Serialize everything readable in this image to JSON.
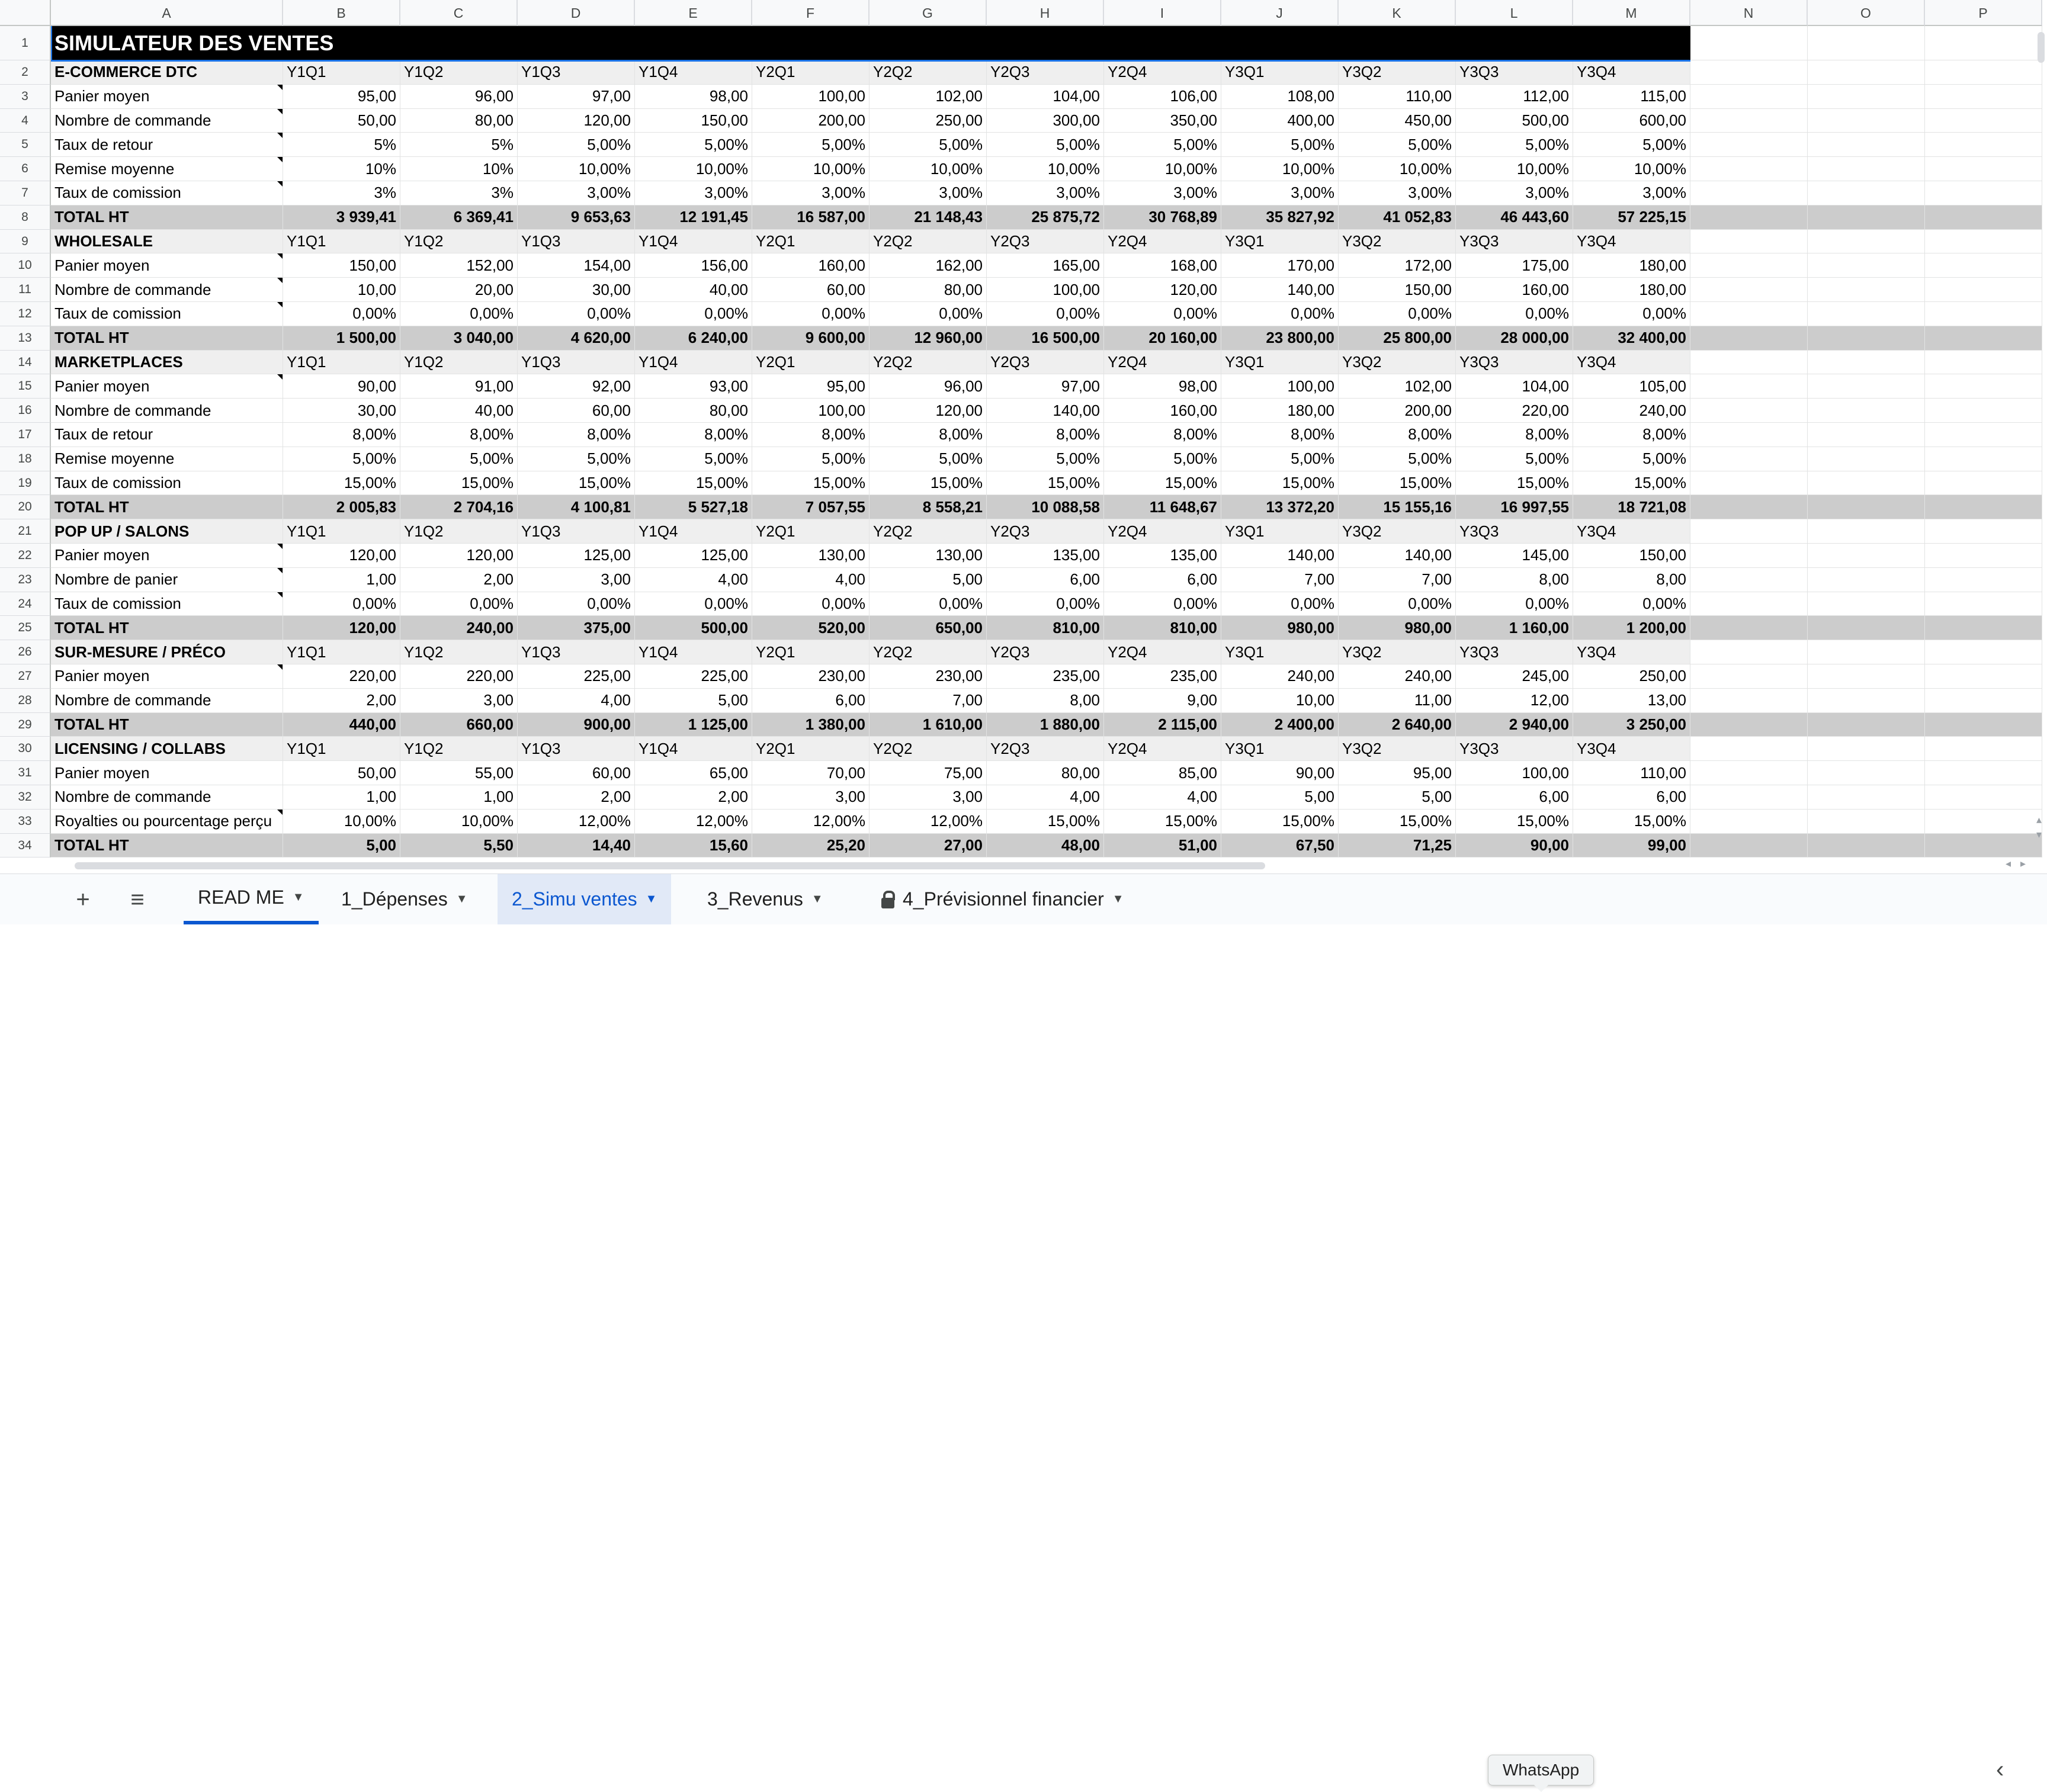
{
  "columns": [
    "A",
    "B",
    "C",
    "D",
    "E",
    "F",
    "G",
    "H",
    "I",
    "J",
    "K",
    "L",
    "M",
    "N",
    "O",
    "P"
  ],
  "title": "SIMULATEUR DES VENTES",
  "rows": [
    {
      "n": "2",
      "kind": "section",
      "label": "E-COMMERCE DTC",
      "values": [
        "Y1Q1",
        "Y1Q2",
        "Y1Q3",
        "Y1Q4",
        "Y2Q1",
        "Y2Q2",
        "Y2Q3",
        "Y2Q4",
        "Y3Q1",
        "Y3Q2",
        "Y3Q3",
        "Y3Q4"
      ]
    },
    {
      "n": "3",
      "kind": "data",
      "label": "Panier moyen",
      "note": true,
      "values": [
        "95,00",
        "96,00",
        "97,00",
        "98,00",
        "100,00",
        "102,00",
        "104,00",
        "106,00",
        "108,00",
        "110,00",
        "112,00",
        "115,00"
      ]
    },
    {
      "n": "4",
      "kind": "data",
      "label": "Nombre de commande",
      "note": true,
      "values": [
        "50,00",
        "80,00",
        "120,00",
        "150,00",
        "200,00",
        "250,00",
        "300,00",
        "350,00",
        "400,00",
        "450,00",
        "500,00",
        "600,00"
      ]
    },
    {
      "n": "5",
      "kind": "data",
      "label": "Taux de retour",
      "note": true,
      "values": [
        "5%",
        "5%",
        "5,00%",
        "5,00%",
        "5,00%",
        "5,00%",
        "5,00%",
        "5,00%",
        "5,00%",
        "5,00%",
        "5,00%",
        "5,00%"
      ]
    },
    {
      "n": "6",
      "kind": "data",
      "label": "Remise moyenne",
      "note": true,
      "values": [
        "10%",
        "10%",
        "10,00%",
        "10,00%",
        "10,00%",
        "10,00%",
        "10,00%",
        "10,00%",
        "10,00%",
        "10,00%",
        "10,00%",
        "10,00%"
      ]
    },
    {
      "n": "7",
      "kind": "data",
      "label": "Taux de comission",
      "note": true,
      "values": [
        "3%",
        "3%",
        "3,00%",
        "3,00%",
        "3,00%",
        "3,00%",
        "3,00%",
        "3,00%",
        "3,00%",
        "3,00%",
        "3,00%",
        "3,00%"
      ]
    },
    {
      "n": "8",
      "kind": "total",
      "label": "TOTAL HT",
      "values": [
        "3 939,41",
        "6 369,41",
        "9 653,63",
        "12 191,45",
        "16 587,00",
        "21 148,43",
        "25 875,72",
        "30 768,89",
        "35 827,92",
        "41 052,83",
        "46 443,60",
        "57 225,15"
      ]
    },
    {
      "n": "9",
      "kind": "section",
      "label": "WHOLESALE",
      "values": [
        "Y1Q1",
        "Y1Q2",
        "Y1Q3",
        "Y1Q4",
        "Y2Q1",
        "Y2Q2",
        "Y2Q3",
        "Y2Q4",
        "Y3Q1",
        "Y3Q2",
        "Y3Q3",
        "Y3Q4"
      ]
    },
    {
      "n": "10",
      "kind": "data",
      "label": "Panier moyen",
      "note": true,
      "values": [
        "150,00",
        "152,00",
        "154,00",
        "156,00",
        "160,00",
        "162,00",
        "165,00",
        "168,00",
        "170,00",
        "172,00",
        "175,00",
        "180,00"
      ]
    },
    {
      "n": "11",
      "kind": "data",
      "label": "Nombre de commande",
      "note": true,
      "values": [
        "10,00",
        "20,00",
        "30,00",
        "40,00",
        "60,00",
        "80,00",
        "100,00",
        "120,00",
        "140,00",
        "150,00",
        "160,00",
        "180,00"
      ]
    },
    {
      "n": "12",
      "kind": "data",
      "label": "Taux de comission",
      "note": true,
      "values": [
        "0,00%",
        "0,00%",
        "0,00%",
        "0,00%",
        "0,00%",
        "0,00%",
        "0,00%",
        "0,00%",
        "0,00%",
        "0,00%",
        "0,00%",
        "0,00%"
      ]
    },
    {
      "n": "13",
      "kind": "total",
      "label": "TOTAL HT",
      "values": [
        "1 500,00",
        "3 040,00",
        "4 620,00",
        "6 240,00",
        "9 600,00",
        "12 960,00",
        "16 500,00",
        "20 160,00",
        "23 800,00",
        "25 800,00",
        "28 000,00",
        "32 400,00"
      ]
    },
    {
      "n": "14",
      "kind": "section",
      "label": "MARKETPLACES",
      "values": [
        "Y1Q1",
        "Y1Q2",
        "Y1Q3",
        "Y1Q4",
        "Y2Q1",
        "Y2Q2",
        "Y2Q3",
        "Y2Q4",
        "Y3Q1",
        "Y3Q2",
        "Y3Q3",
        "Y3Q4"
      ]
    },
    {
      "n": "15",
      "kind": "data",
      "label": "Panier moyen",
      "note": true,
      "values": [
        "90,00",
        "91,00",
        "92,00",
        "93,00",
        "95,00",
        "96,00",
        "97,00",
        "98,00",
        "100,00",
        "102,00",
        "104,00",
        "105,00"
      ]
    },
    {
      "n": "16",
      "kind": "data",
      "label": "Nombre de commande",
      "values": [
        "30,00",
        "40,00",
        "60,00",
        "80,00",
        "100,00",
        "120,00",
        "140,00",
        "160,00",
        "180,00",
        "200,00",
        "220,00",
        "240,00"
      ]
    },
    {
      "n": "17",
      "kind": "data",
      "label": "Taux de retour",
      "values": [
        "8,00%",
        "8,00%",
        "8,00%",
        "8,00%",
        "8,00%",
        "8,00%",
        "8,00%",
        "8,00%",
        "8,00%",
        "8,00%",
        "8,00%",
        "8,00%"
      ]
    },
    {
      "n": "18",
      "kind": "data",
      "label": "Remise moyenne",
      "values": [
        "5,00%",
        "5,00%",
        "5,00%",
        "5,00%",
        "5,00%",
        "5,00%",
        "5,00%",
        "5,00%",
        "5,00%",
        "5,00%",
        "5,00%",
        "5,00%"
      ]
    },
    {
      "n": "19",
      "kind": "data",
      "label": "Taux de comission",
      "values": [
        "15,00%",
        "15,00%",
        "15,00%",
        "15,00%",
        "15,00%",
        "15,00%",
        "15,00%",
        "15,00%",
        "15,00%",
        "15,00%",
        "15,00%",
        "15,00%"
      ]
    },
    {
      "n": "20",
      "kind": "total",
      "label": "TOTAL HT",
      "values": [
        "2 005,83",
        "2 704,16",
        "4 100,81",
        "5 527,18",
        "7 057,55",
        "8 558,21",
        "10 088,58",
        "11 648,67",
        "13 372,20",
        "15 155,16",
        "16 997,55",
        "18 721,08"
      ]
    },
    {
      "n": "21",
      "kind": "section",
      "label": "POP UP / SALONS",
      "values": [
        "Y1Q1",
        "Y1Q2",
        "Y1Q3",
        "Y1Q4",
        "Y2Q1",
        "Y2Q2",
        "Y2Q3",
        "Y2Q4",
        "Y3Q1",
        "Y3Q2",
        "Y3Q3",
        "Y3Q4"
      ]
    },
    {
      "n": "22",
      "kind": "data",
      "label": "Panier moyen",
      "note": true,
      "values": [
        "120,00",
        "120,00",
        "125,00",
        "125,00",
        "130,00",
        "130,00",
        "135,00",
        "135,00",
        "140,00",
        "140,00",
        "145,00",
        "150,00"
      ]
    },
    {
      "n": "23",
      "kind": "data",
      "label": "Nombre de panier",
      "note": true,
      "values": [
        "1,00",
        "2,00",
        "3,00",
        "4,00",
        "4,00",
        "5,00",
        "6,00",
        "6,00",
        "7,00",
        "7,00",
        "8,00",
        "8,00"
      ]
    },
    {
      "n": "24",
      "kind": "data",
      "label": "Taux de comission",
      "note": true,
      "values": [
        "0,00%",
        "0,00%",
        "0,00%",
        "0,00%",
        "0,00%",
        "0,00%",
        "0,00%",
        "0,00%",
        "0,00%",
        "0,00%",
        "0,00%",
        "0,00%"
      ]
    },
    {
      "n": "25",
      "kind": "total",
      "label": "TOTAL HT",
      "values": [
        "120,00",
        "240,00",
        "375,00",
        "500,00",
        "520,00",
        "650,00",
        "810,00",
        "810,00",
        "980,00",
        "980,00",
        "1 160,00",
        "1 200,00"
      ]
    },
    {
      "n": "26",
      "kind": "section",
      "label": "SUR-MESURE / PRÉCO",
      "values": [
        "Y1Q1",
        "Y1Q2",
        "Y1Q3",
        "Y1Q4",
        "Y2Q1",
        "Y2Q2",
        "Y2Q3",
        "Y2Q4",
        "Y3Q1",
        "Y3Q2",
        "Y3Q3",
        "Y3Q4"
      ]
    },
    {
      "n": "27",
      "kind": "data",
      "label": "Panier moyen",
      "note": true,
      "values": [
        "220,00",
        "220,00",
        "225,00",
        "225,00",
        "230,00",
        "230,00",
        "235,00",
        "235,00",
        "240,00",
        "240,00",
        "245,00",
        "250,00"
      ]
    },
    {
      "n": "28",
      "kind": "data",
      "label": "Nombre de commande",
      "values": [
        "2,00",
        "3,00",
        "4,00",
        "5,00",
        "6,00",
        "7,00",
        "8,00",
        "9,00",
        "10,00",
        "11,00",
        "12,00",
        "13,00"
      ]
    },
    {
      "n": "29",
      "kind": "total",
      "label": "TOTAL HT",
      "values": [
        "440,00",
        "660,00",
        "900,00",
        "1 125,00",
        "1 380,00",
        "1 610,00",
        "1 880,00",
        "2 115,00",
        "2 400,00",
        "2 640,00",
        "2 940,00",
        "3 250,00"
      ]
    },
    {
      "n": "30",
      "kind": "section",
      "label": "LICENSING / COLLABS",
      "values": [
        "Y1Q1",
        "Y1Q2",
        "Y1Q3",
        "Y1Q4",
        "Y2Q1",
        "Y2Q2",
        "Y2Q3",
        "Y2Q4",
        "Y3Q1",
        "Y3Q2",
        "Y3Q3",
        "Y3Q4"
      ]
    },
    {
      "n": "31",
      "kind": "data",
      "label": "Panier moyen",
      "values": [
        "50,00",
        "55,00",
        "60,00",
        "65,00",
        "70,00",
        "75,00",
        "80,00",
        "85,00",
        "90,00",
        "95,00",
        "100,00",
        "110,00"
      ]
    },
    {
      "n": "32",
      "kind": "data",
      "label": "Nombre de commande",
      "values": [
        "1,00",
        "1,00",
        "2,00",
        "2,00",
        "3,00",
        "3,00",
        "4,00",
        "4,00",
        "5,00",
        "5,00",
        "6,00",
        "6,00"
      ]
    },
    {
      "n": "33",
      "kind": "data",
      "label": "Royalties ou pourcentage perçu",
      "note": true,
      "values": [
        "10,00%",
        "10,00%",
        "12,00%",
        "12,00%",
        "12,00%",
        "12,00%",
        "15,00%",
        "15,00%",
        "15,00%",
        "15,00%",
        "15,00%",
        "15,00%"
      ]
    },
    {
      "n": "34",
      "kind": "total",
      "label": "TOTAL HT",
      "values": [
        "5,00",
        "5,50",
        "14,40",
        "15,60",
        "25,20",
        "27,00",
        "48,00",
        "51,00",
        "67,50",
        "71,25",
        "90,00",
        "99,00"
      ]
    }
  ],
  "tabbar": {
    "add_icon": "plus-icon",
    "menu_icon": "hamburger-menu-icon",
    "tabs": [
      {
        "label": "READ ME",
        "state": "underlined"
      },
      {
        "label": "1_Dépenses",
        "state": "normal"
      },
      {
        "label": "2_Simu ventes",
        "state": "active"
      },
      {
        "label": "3_Revenus",
        "state": "normal"
      },
      {
        "label": "4_Prévisionnel financier",
        "state": "locked"
      }
    ],
    "tooltip": "WhatsApp",
    "collapse_icon": "chevron-left-icon"
  },
  "colors": {
    "accent": "#0b57d0",
    "title_bg": "#000000",
    "section_bg": "#efefef",
    "total_bg": "#cccccc",
    "header_bg": "#f8f9fa"
  }
}
